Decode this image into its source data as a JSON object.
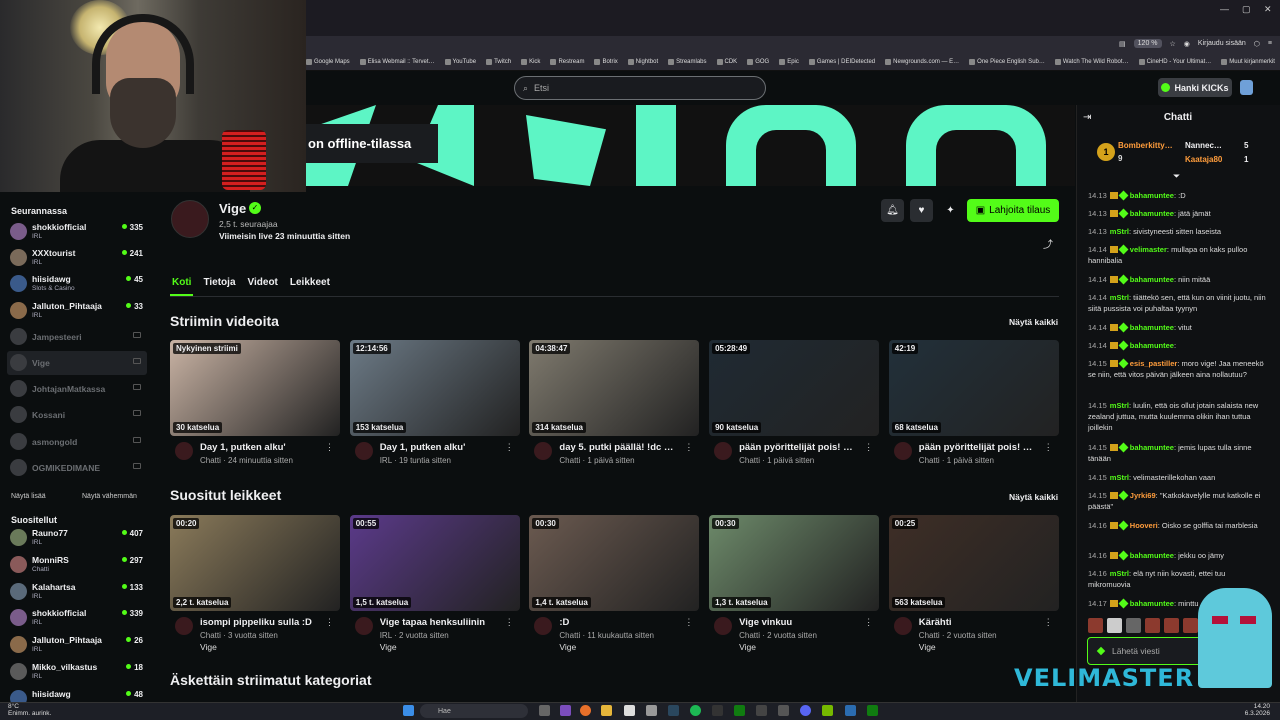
{
  "browser": {
    "zoom": "120 %",
    "login": "Kirjaudu sisään",
    "bookmarks": [
      "Google Maps",
      "Elisa Webmail :: Tervet…",
      "YouTube",
      "Twitch",
      "Kick",
      "Restream",
      "Botrix",
      "Nightbot",
      "Streamlabs",
      "CDK",
      "GOG",
      "Epic",
      "Games | DEIDetected",
      "Newgrounds.com — E…",
      "One Piece English Sub…",
      "Watch The Wild Robot…",
      "CineHD - Your Ultimat…",
      "Muut kirjanmerkit"
    ]
  },
  "header": {
    "search_placeholder": "Etsi",
    "kicks_label": "Hanki KICKs"
  },
  "banner": {
    "offline_text": "on offline-tilassa"
  },
  "sidebar": {
    "following_title": "Seurannassa",
    "following": [
      {
        "name": "shokkiofficial",
        "category": "IRL",
        "viewers": "335",
        "live": true
      },
      {
        "name": "XXXtourist",
        "category": "IRL",
        "viewers": "241",
        "live": true
      },
      {
        "name": "hiisidawg",
        "category": "Slots & Casino",
        "viewers": "45",
        "live": true
      },
      {
        "name": "Jalluton_Pihtaaja",
        "category": "IRL",
        "viewers": "33",
        "live": true
      },
      {
        "name": "Jampesteeri",
        "live": false
      },
      {
        "name": "Vige",
        "live": false
      },
      {
        "name": "JohtajanMatkassa",
        "live": false
      },
      {
        "name": "Kossani",
        "live": false
      },
      {
        "name": "asmongold",
        "live": false
      },
      {
        "name": "OGMIKEDIMANE",
        "live": false
      }
    ],
    "show_more": "Näytä lisää",
    "show_less": "Näytä vähemmän",
    "recommended_title": "Suositellut",
    "recommended": [
      {
        "name": "Rauno77",
        "category": "IRL",
        "viewers": "407"
      },
      {
        "name": "MonniRS",
        "category": "Chatti",
        "viewers": "297"
      },
      {
        "name": "Kalahartsa",
        "category": "IRL",
        "viewers": "133"
      },
      {
        "name": "shokkiofficial",
        "category": "IRL",
        "viewers": "339"
      },
      {
        "name": "Jalluton_Pihtaaja",
        "category": "IRL",
        "viewers": "26"
      },
      {
        "name": "Mikko_vilkastus",
        "category": "IRL",
        "viewers": "18"
      },
      {
        "name": "hiisidawg",
        "category": "",
        "viewers": "48"
      }
    ]
  },
  "channel": {
    "name": "Vige",
    "followers": "2,5 t. seuraajaa",
    "last_live": "Viimeisin live 23 minuuttia sitten",
    "gift_label": "Lahjoita tilaus",
    "tabs": [
      "Koti",
      "Tietoja",
      "Videot",
      "Leikkeet"
    ]
  },
  "videos_section": {
    "title": "Striimin videoita",
    "show_all": "Näytä kaikki",
    "items": [
      {
        "badge": "Nykyinen striimi",
        "views": "30 katselua",
        "title": "Day 1, putken alku'",
        "meta": "Chatti · 24 minuuttia sitten",
        "color": "#c9b3a4"
      },
      {
        "badge": "12:14:56",
        "views": "153 katselua",
        "title": "Day 1, putken alku'",
        "meta": "IRL · 19 tuntia sitten",
        "color": "#6c7a86"
      },
      {
        "badge": "04:38:47",
        "views": "314 katselua",
        "title": "day 5. putki päällä! !dc …",
        "meta": "Chatti · 1 päivä sitten",
        "color": "#7f7a6e"
      },
      {
        "badge": "05:28:49",
        "views": "90 katselua",
        "title": "pään pyörittelijät pois! …",
        "meta": "Chatti · 1 päivä sitten",
        "color": "#1f2a33"
      },
      {
        "badge": "42:19",
        "views": "68 katselua",
        "title": "pään pyörittelijät pois! …",
        "meta": "Chatti · 1 päivä sitten",
        "color": "#22303a"
      }
    ]
  },
  "clips_section": {
    "title": "Suositut leikkeet",
    "show_all": "Näytä kaikki",
    "items": [
      {
        "badge": "00:20",
        "views": "2,2 t. katselua",
        "title": "isompi pippeliku sulla :D",
        "meta": "Chatti · 3 vuotta sitten",
        "by": "Vige",
        "color": "#8a7a5a"
      },
      {
        "badge": "00:55",
        "views": "1,5 t. katselua",
        "title": "Vige tapaa henksuliinin",
        "meta": "IRL · 2 vuotta sitten",
        "by": "Vige",
        "color": "#5b3a8a"
      },
      {
        "badge": "00:30",
        "views": "1,4 t. katselua",
        "title": ":D",
        "meta": "Chatti · 11 kuukautta sitten",
        "by": "Vige",
        "color": "#6b5a50"
      },
      {
        "badge": "00:30",
        "views": "1,3 t. katselua",
        "title": "Vige vinkuu",
        "meta": "Chatti · 2 vuotta sitten",
        "by": "Vige",
        "color": "#6d8a6a"
      },
      {
        "badge": "00:25",
        "views": "563 katselua",
        "title": "Kärähti",
        "meta": "Chatti · 2 vuotta sitten",
        "by": "Vige",
        "color": "#3e2e26"
      }
    ]
  },
  "categories_section": {
    "title": "Äskettäin striimatut kategoriat"
  },
  "chat": {
    "title": "Chatti",
    "leaderboard": [
      {
        "name": "Bomberkitty…",
        "count": "9"
      },
      {
        "name": "Nannec…",
        "count": "5"
      },
      {
        "name": "Kaataja80",
        "count": "1"
      }
    ],
    "messages": [
      {
        "time": "14.13",
        "user": "bahamuntee",
        "color": "#53fc18",
        "text": ":D"
      },
      {
        "time": "14.13",
        "user": "bahamuntee",
        "color": "#53fc18",
        "text": "jätä jämät"
      },
      {
        "time": "14.13",
        "user": "mStrl",
        "color": "#53fc18",
        "text": "sivistyneesti sitten laseista"
      },
      {
        "time": "14.14",
        "user": "velimaster",
        "color": "#53fc18",
        "text": "mullapa on kaks pulloo hannibalia"
      },
      {
        "time": "14.14",
        "user": "bahamuntee",
        "color": "#53fc18",
        "text": "niin mitää"
      },
      {
        "time": "14.14",
        "user": "mStrl",
        "color": "#53fc18",
        "text": "tiiättekö sen, että kun on viinit juotu, niin siitä pussista voi puhaltaa tyynyn"
      },
      {
        "time": "14.14",
        "user": "bahamuntee",
        "color": "#53fc18",
        "text": "vitut"
      },
      {
        "time": "14.14",
        "user": "bahamuntee",
        "color": "#53fc18",
        "text": ""
      },
      {
        "time": "14.15",
        "user": "esis_pastiller",
        "color": "#ff9d3c",
        "text": "moro vige! Jaa meneekö se niin, että vitos päivän jälkeen aina nollautuu?"
      },
      {
        "time": "14.15",
        "user": "mStrl",
        "color": "#53fc18",
        "text": "luulin, että ois ollut jotain salaista new zealand juttua, mutta kuulemma olikin ihan tuttua joillekin"
      },
      {
        "time": "14.15",
        "user": "bahamuntee",
        "color": "#53fc18",
        "text": "jemis lupas tulla sinne tänään"
      },
      {
        "time": "14.15",
        "user": "mStrl",
        "color": "#53fc18",
        "text": "velimasterillekohan vaan"
      },
      {
        "time": "14.15",
        "user": "Jyrki69",
        "color": "#ff9d3c",
        "text": "\"Katkokävelylle mut katkolle ei päästä\""
      },
      {
        "time": "14.16",
        "user": "Hooveri",
        "color": "#ff9d3c",
        "text": "Oisko se golffia tai marblesia"
      },
      {
        "time": "14.16",
        "user": "bahamuntee",
        "color": "#53fc18",
        "text": "jekku oo jämy"
      },
      {
        "time": "14.16",
        "user": "mStrl",
        "color": "#53fc18",
        "text": "elä nyt niin kovasti, ettei tuu mikromuovia"
      },
      {
        "time": "14.17",
        "user": "bahamuntee",
        "color": "#53fc18",
        "text": "minttu"
      }
    ],
    "input_placeholder": "Lähetä viesti",
    "overlay_text": "VELIMASTER"
  },
  "taskbar": {
    "weather_temp": "8°C",
    "weather_desc": "Enimm. aurink.",
    "search": "Hae",
    "time": "14.20",
    "date": "6.3.2026"
  },
  "colors": {
    "accent": "#53fc18",
    "background": "#0b0e0f",
    "banner": "#5df5c5"
  }
}
